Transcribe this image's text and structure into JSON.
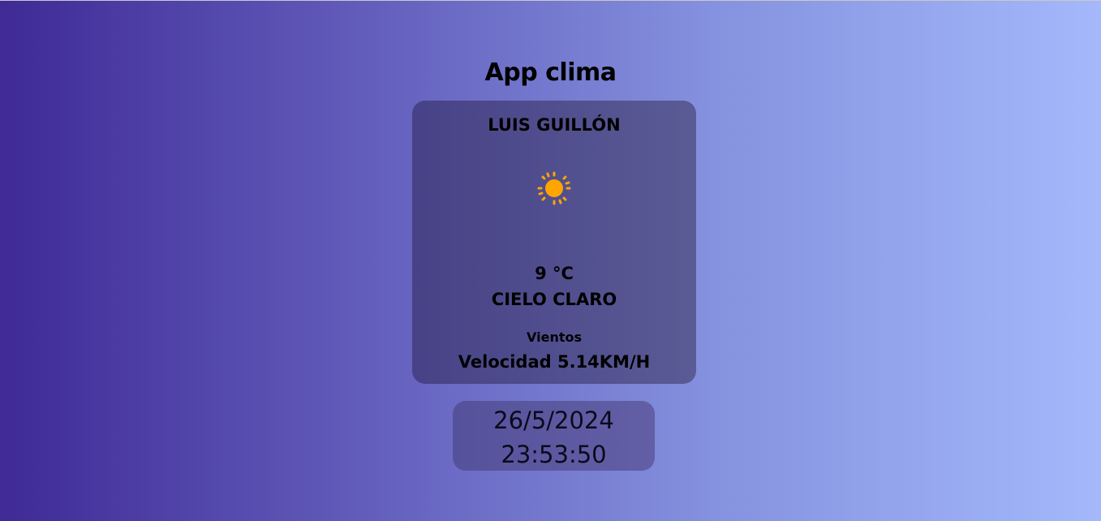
{
  "app": {
    "title": "App clima"
  },
  "weather": {
    "city": "LUIS GUILLÓN",
    "icon": "sun-icon",
    "temperature": "9 °C",
    "condition": "CIELO CLARO",
    "wind_label": "Vientos",
    "wind_speed": "Velocidad 5.14KM/H"
  },
  "clock": {
    "date": "26/5/2024",
    "time": "23:53:50"
  },
  "colors": {
    "gradient_start": "#3f2a96",
    "gradient_end": "#a4b8fb",
    "card": "#4f4d8e",
    "sun": "#ffa500"
  }
}
